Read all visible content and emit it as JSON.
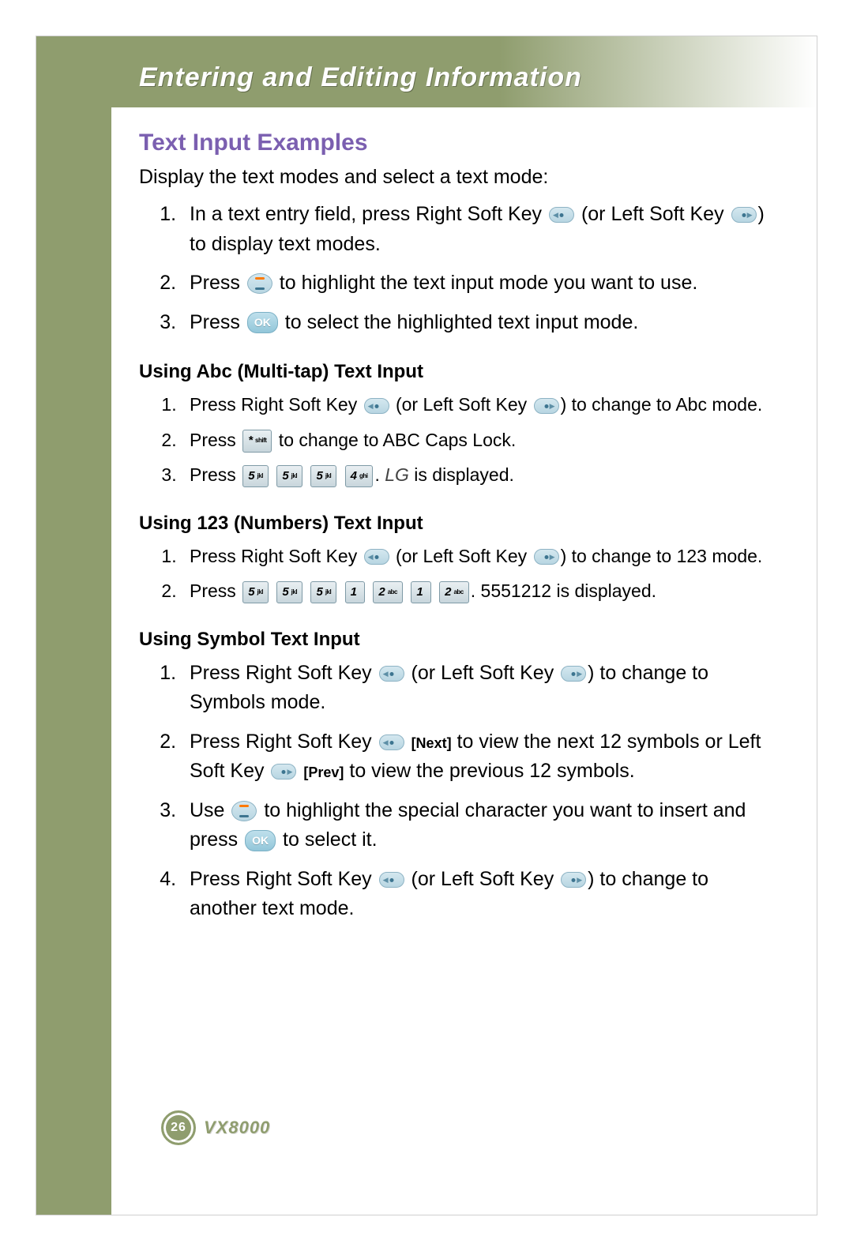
{
  "header": {
    "title": "Entering and Editing Information"
  },
  "section": {
    "title": "Text Input Examples",
    "intro": "Display the text modes and select a text mode:",
    "steps": [
      {
        "parts": [
          "In a text entry field, press Right Soft Key ",
          {
            "icon": "softkey-left"
          },
          " (or Left Soft Key ",
          {
            "icon": "softkey-right"
          },
          ") to display text modes."
        ]
      },
      {
        "parts": [
          "Press ",
          {
            "icon": "nav"
          },
          " to highlight the text input mode you want to use."
        ]
      },
      {
        "parts": [
          "Press ",
          {
            "icon": "ok",
            "label": "OK"
          },
          " to select the highlighted text input mode."
        ]
      }
    ]
  },
  "abc": {
    "title": "Using Abc (Multi-tap) Text Input",
    "steps": [
      {
        "parts": [
          "Press Right Soft Key ",
          {
            "icon": "softkey-left"
          },
          " (or Left Soft Key ",
          {
            "icon": "softkey-right"
          },
          ") to change to Abc mode."
        ]
      },
      {
        "parts": [
          "Press ",
          {
            "icon": "key",
            "num": "*",
            "lbl": "shift"
          },
          " to change to ABC Caps Lock."
        ]
      },
      {
        "parts": [
          "Press ",
          {
            "icon": "key",
            "num": "5",
            "lbl": "jkl"
          },
          " ",
          {
            "icon": "key",
            "num": "5",
            "lbl": "jkl"
          },
          " ",
          {
            "icon": "key",
            "num": "5",
            "lbl": "jkl"
          },
          " ",
          {
            "icon": "key",
            "num": "4",
            "lbl": "ghi"
          },
          ". ",
          {
            "italic": "LG"
          },
          " is displayed."
        ]
      }
    ]
  },
  "num": {
    "title": "Using 123 (Numbers) Text Input",
    "steps": [
      {
        "parts": [
          "Press Right Soft Key ",
          {
            "icon": "softkey-left"
          },
          "  (or Left Soft Key ",
          {
            "icon": "softkey-right"
          },
          ") to change to 123 mode."
        ]
      },
      {
        "parts": [
          "Press ",
          {
            "icon": "key",
            "num": "5",
            "lbl": "jkl"
          },
          " ",
          {
            "icon": "key",
            "num": "5",
            "lbl": "jkl"
          },
          " ",
          {
            "icon": "key",
            "num": "5",
            "lbl": "jkl"
          },
          " ",
          {
            "icon": "key",
            "num": "1",
            "lbl": ""
          },
          " ",
          {
            "icon": "key",
            "num": "2",
            "lbl": "abc"
          },
          " ",
          {
            "icon": "key",
            "num": "1",
            "lbl": ""
          },
          " ",
          {
            "icon": "key",
            "num": "2",
            "lbl": "abc"
          },
          ". 5551212 is displayed."
        ]
      }
    ]
  },
  "sym": {
    "title": "Using Symbol Text Input",
    "steps": [
      {
        "parts": [
          "Press Right Soft Key ",
          {
            "icon": "softkey-left"
          },
          " (or Left Soft Key ",
          {
            "icon": "softkey-right"
          },
          ") to change to Symbols mode."
        ]
      },
      {
        "parts": [
          "Press Right Soft Key ",
          {
            "icon": "softkey-left"
          },
          " ",
          {
            "bold": "[Next]"
          },
          " to view the next 12 symbols or Left Soft Key ",
          {
            "icon": "softkey-right"
          },
          " ",
          {
            "bold": "[Prev]"
          },
          " to view the previous 12 symbols."
        ]
      },
      {
        "parts": [
          "Use ",
          {
            "icon": "nav"
          },
          " to highlight the special character you want to insert and press ",
          {
            "icon": "ok",
            "label": "OK"
          },
          " to select it."
        ]
      },
      {
        "parts": [
          "Press Right Soft Key ",
          {
            "icon": "softkey-left"
          },
          " (or Left Soft Key ",
          {
            "icon": "softkey-right"
          },
          ") to change to another text mode."
        ]
      }
    ]
  },
  "footer": {
    "page": "26",
    "model": "VX8000"
  },
  "ok_label": "OK"
}
